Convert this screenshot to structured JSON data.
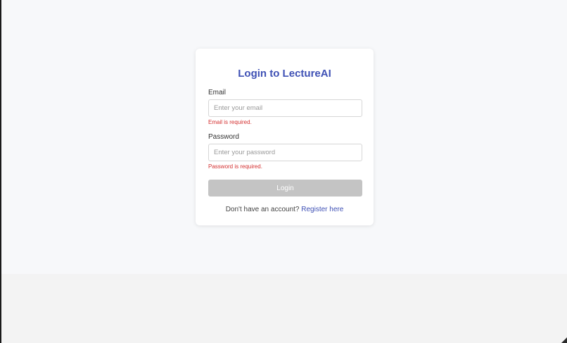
{
  "login": {
    "title": "Login to LectureAI",
    "email": {
      "label": "Email",
      "value": "",
      "placeholder": "Enter your email",
      "error": "Email is required."
    },
    "password": {
      "label": "Password",
      "value": "",
      "placeholder": "Enter your password",
      "error": "Password is required."
    },
    "submit_label": "Login",
    "register_prompt": "Don't have an account?",
    "register_link": "Register here"
  },
  "colors": {
    "accent": "#3f51b5",
    "error": "#d32f2f",
    "disabled_button": "#c4c4c4"
  }
}
